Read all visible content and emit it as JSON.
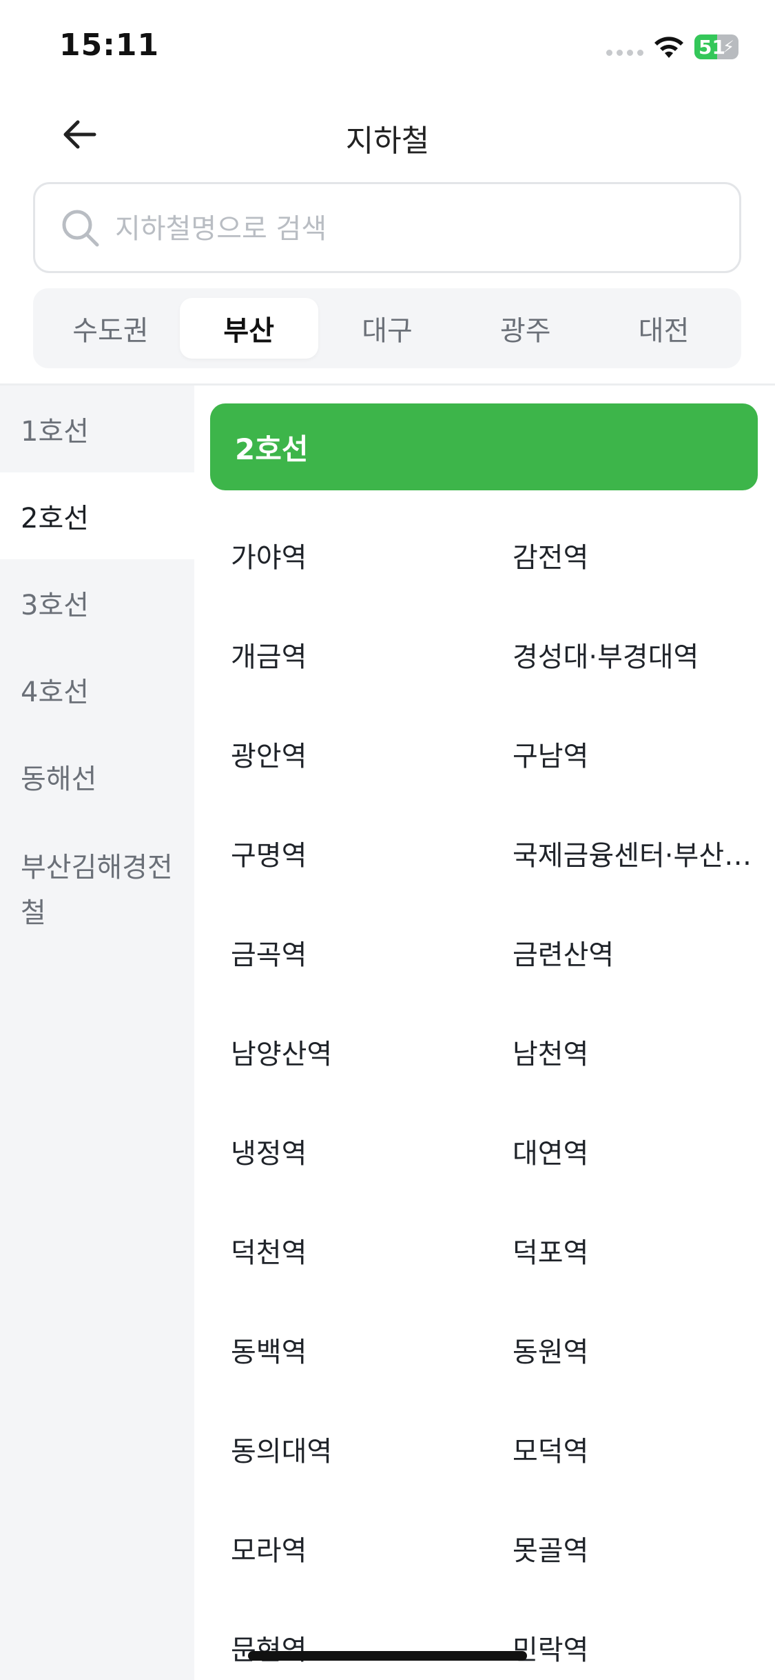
{
  "status_bar": {
    "time": "15:11",
    "battery": "51",
    "battery_level": 0.51
  },
  "header": {
    "title": "지하철",
    "back_icon": "arrow-left-icon"
  },
  "search": {
    "placeholder": "지하철명으로 검색",
    "value": "",
    "icon": "search-icon"
  },
  "region_tabs": [
    {
      "label": "수도권",
      "active": false
    },
    {
      "label": "부산",
      "active": true
    },
    {
      "label": "대구",
      "active": false
    },
    {
      "label": "광주",
      "active": false
    },
    {
      "label": "대전",
      "active": false
    }
  ],
  "lines": [
    {
      "label": "1호선",
      "active": false
    },
    {
      "label": "2호선",
      "active": true
    },
    {
      "label": "3호선",
      "active": false
    },
    {
      "label": "4호선",
      "active": false
    },
    {
      "label": "동해선",
      "active": false
    },
    {
      "label": "부산김해경전철",
      "active": false
    }
  ],
  "selected_line": {
    "label": "2호선",
    "color": "#3db54a"
  },
  "stations": [
    "가야역",
    "감전역",
    "개금역",
    "경성대·부경대역",
    "광안역",
    "구남역",
    "구명역",
    "국제금융센터·부산…",
    "금곡역",
    "금련산역",
    "남양산역",
    "남천역",
    "냉정역",
    "대연역",
    "덕천역",
    "덕포역",
    "동백역",
    "동원역",
    "동의대역",
    "모덕역",
    "모라역",
    "못골역",
    "문현역",
    "민락역"
  ],
  "colors": {
    "accent": "#3db54a",
    "sidebar_bg": "#f4f5f7",
    "muted_text": "#6b7078"
  }
}
